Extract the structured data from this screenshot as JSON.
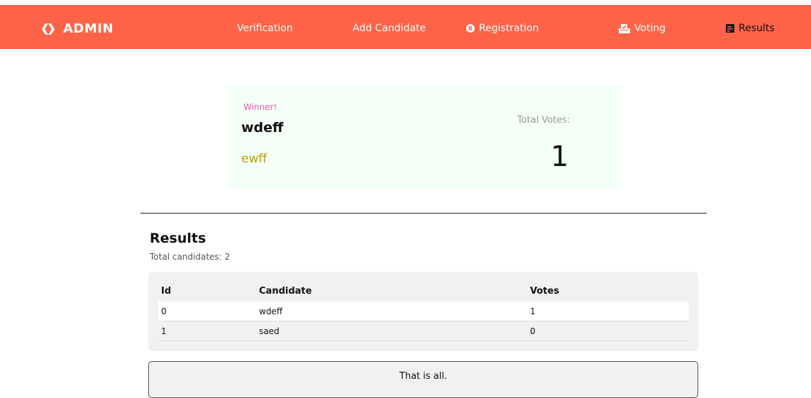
{
  "nav": {
    "brand": "ADMIN",
    "links": [
      {
        "label": "Verification"
      },
      {
        "label": "Add Candidate"
      },
      {
        "label": "Registration"
      },
      {
        "label": "Voting"
      },
      {
        "label": "Results"
      }
    ]
  },
  "winner": {
    "label": "Winner!",
    "name": "wdeff",
    "party": "ewff",
    "total_label": "Total Votes:",
    "total_value": "1"
  },
  "results": {
    "title": "Results",
    "count_text": "Total candidates: 2",
    "headers": [
      "Id",
      "Candidate",
      "Votes"
    ],
    "rows": [
      [
        "0",
        "wdeff",
        "1"
      ],
      [
        "1",
        "saed",
        "0"
      ]
    ]
  },
  "footer": {
    "text": "That is all."
  },
  "colors": {
    "navbar": "#ff6347",
    "winner_bg": "#f4fff7",
    "winner_label": "#e85db5",
    "party": "#b8a000"
  },
  "icons": {
    "brand": "double-chevron-icon",
    "registration": "registered-icon",
    "voting": "ballot-box-icon",
    "results": "poll-icon"
  }
}
